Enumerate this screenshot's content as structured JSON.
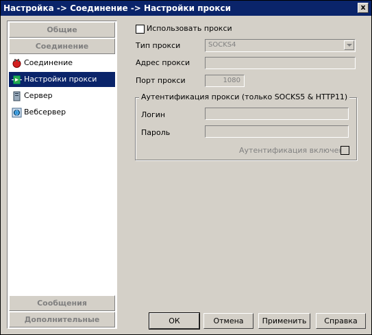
{
  "window": {
    "title": "Настройка -> Соединение -> Настройки прокси",
    "close_label": "x"
  },
  "sidebar": {
    "groups": {
      "general": "Общие",
      "connection": "Соединение",
      "messages": "Сообщения",
      "advanced": "Дополнительные"
    },
    "items": [
      {
        "label": "Соединение",
        "icon": "plug-icon",
        "selected": false
      },
      {
        "label": "Настройки прокси",
        "icon": "proxy-icon",
        "selected": true
      },
      {
        "label": "Сервер",
        "icon": "server-icon",
        "selected": false
      },
      {
        "label": "Вебсервер",
        "icon": "globe-icon",
        "selected": false
      }
    ]
  },
  "proxy": {
    "use_proxy_label": "Использовать прокси",
    "use_proxy_checked": false,
    "type_label": "Тип прокси",
    "type_value": "SOCKS4",
    "address_label": "Адрес прокси",
    "address_value": "",
    "port_label": "Порт прокси",
    "port_value": "1080"
  },
  "auth": {
    "group_title": "Аутентификация прокси (только SOCKS5 & HTTP11)",
    "login_label": "Логин",
    "login_value": "",
    "password_label": "Пароль",
    "password_value": "",
    "enabled_label": "Аутентификация включена",
    "enabled_checked": false
  },
  "buttons": {
    "ok": "ОК",
    "cancel": "Отмена",
    "apply": "Применить",
    "help": "Справка"
  },
  "colors": {
    "titlebar": "#0a246a",
    "selection": "#0a246a",
    "face": "#d4d0c8"
  }
}
